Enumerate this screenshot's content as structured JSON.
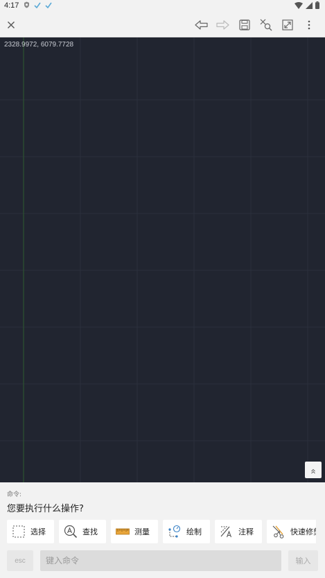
{
  "status_bar": {
    "time": "4:17",
    "icons": [
      "shield-icon",
      "check-icon",
      "check-icon",
      "wifi-icon",
      "signal-icon",
      "battery-icon"
    ]
  },
  "toolbar": {
    "icons": [
      "close-icon",
      "undo-icon",
      "redo-icon",
      "save-icon",
      "zoom-extent-icon",
      "fullscreen-icon",
      "more-icon"
    ]
  },
  "canvas": {
    "coordinates": "2328.9972, 6079.7728",
    "background": "#212530",
    "grid_color": "#2d3340",
    "axis_color": "#2f5a2f"
  },
  "command": {
    "label": "命令:",
    "prompt": "您要执行什么操作?",
    "tools": [
      {
        "label": "选择",
        "icon": "select-icon"
      },
      {
        "label": "查找",
        "icon": "find-icon"
      },
      {
        "label": "测量",
        "icon": "measure-icon"
      },
      {
        "label": "绘制",
        "icon": "draw-icon"
      },
      {
        "label": "注释",
        "icon": "annotate-icon"
      },
      {
        "label": "快速修剪",
        "icon": "quick-trim-icon"
      }
    ],
    "esc_label": "esc",
    "input_placeholder": "键入命令",
    "enter_label": "输入"
  }
}
